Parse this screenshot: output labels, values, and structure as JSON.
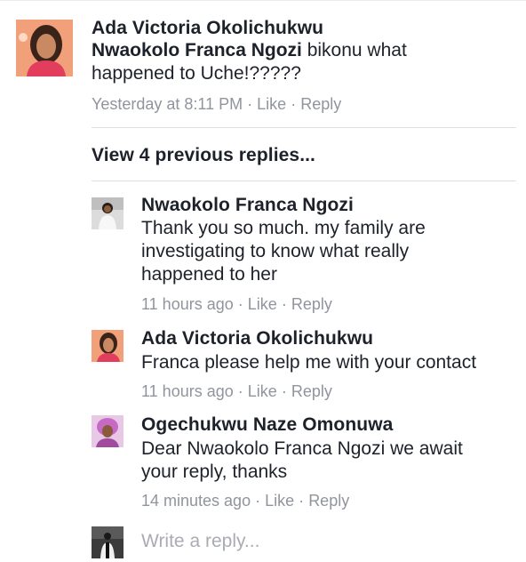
{
  "main_comment": {
    "author": "Ada Victoria Okolichukwu",
    "mention": "Nwaokolo Franca Ngozi",
    "text_line1": " bikonu what",
    "text_line2": "happened to Uche!?????",
    "time": "Yesterday at 8:11 PM",
    "sep": "·",
    "like": "Like",
    "reply": "Reply"
  },
  "view_previous": "View 4 previous replies...",
  "replies": [
    {
      "author": "Nwaokolo Franca Ngozi",
      "lines": [
        "Thank you so much. my family are",
        "investigating to know what really",
        "happened to her"
      ],
      "time": "11 hours ago",
      "like": "Like",
      "reply": "Reply"
    },
    {
      "author": "Ada Victoria Okolichukwu",
      "lines": [
        "Franca please help me with your contact"
      ],
      "time": "11 hours ago",
      "like": "Like",
      "reply": "Reply"
    },
    {
      "author": "Ogechukwu Naze Omonuwa",
      "lines": [
        "Dear Nwaokolo Franca Ngozi we await",
        "your reply, thanks"
      ],
      "time": "14 minutes ago",
      "like": "Like",
      "reply": "Reply"
    }
  ],
  "composer": {
    "placeholder": "Write a reply..."
  },
  "icons": {
    "avatar_main": "profile-photo",
    "avatar_reply1": "profile-photo",
    "avatar_reply2": "profile-photo",
    "avatar_reply3": "profile-photo",
    "avatar_composer": "profile-photo"
  },
  "colors": {
    "text": "#1d2129",
    "meta": "#90949c",
    "divider": "#dddfe2",
    "avatar_bg_ada": "#f2a07a",
    "avatar_bg_oge": "#d9a0d8"
  }
}
